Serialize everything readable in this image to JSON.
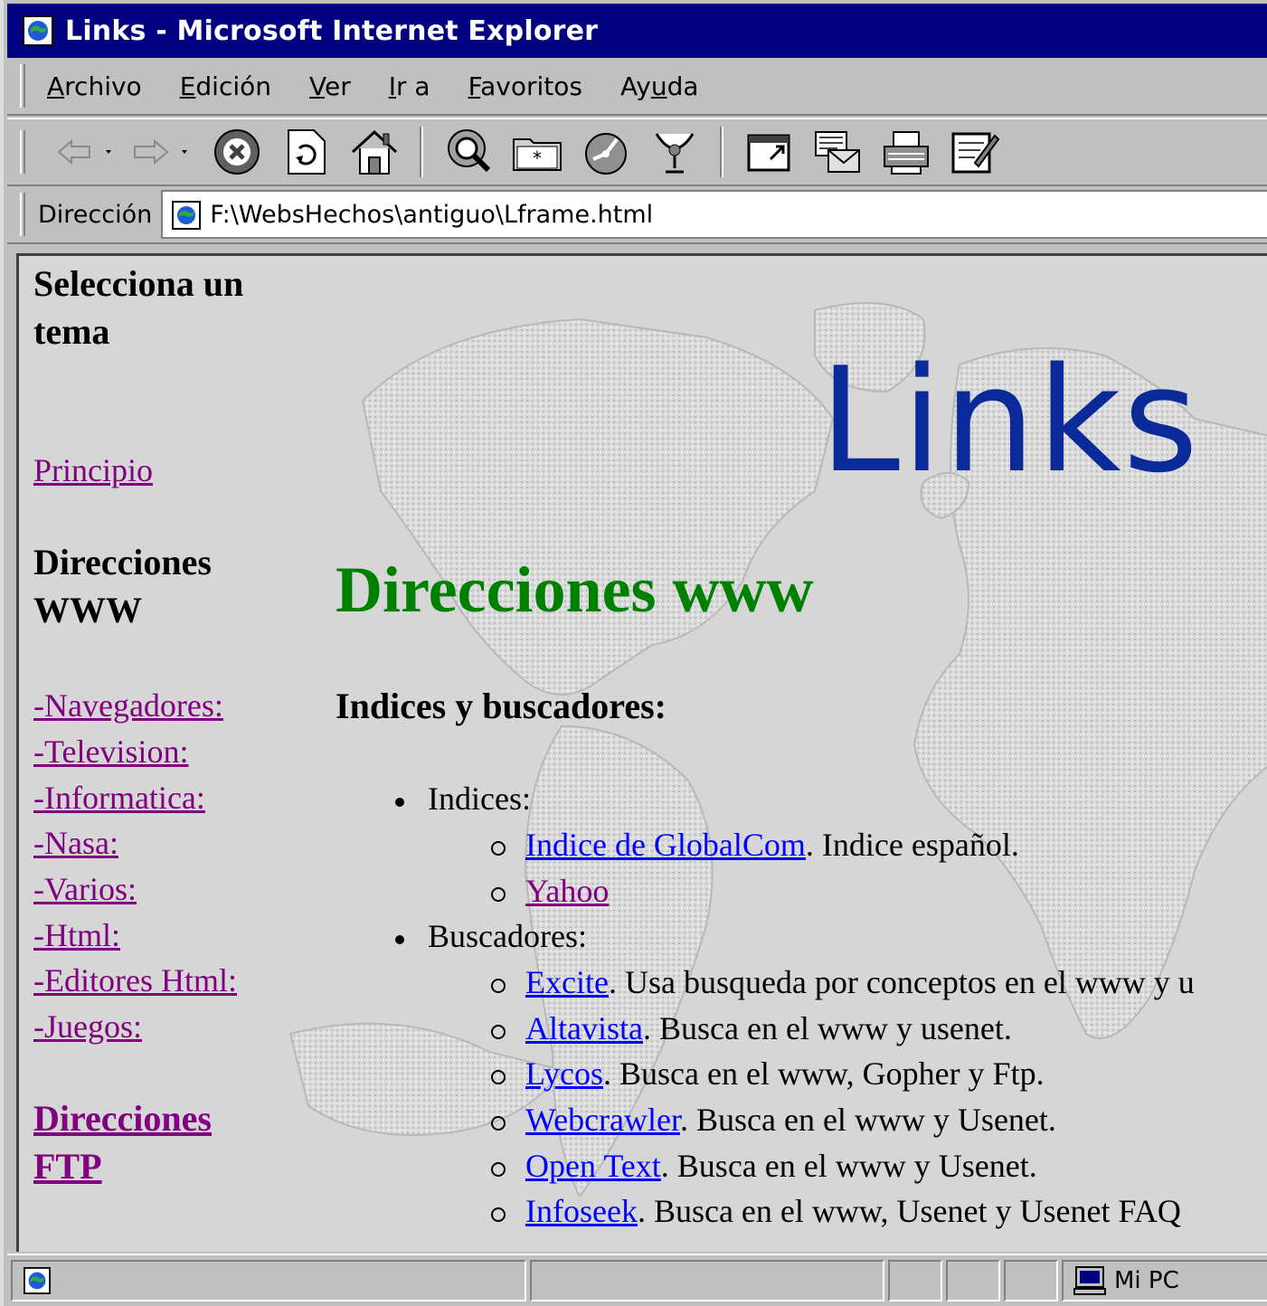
{
  "window": {
    "title": "Links - Microsoft Internet Explorer"
  },
  "menu": {
    "items": [
      {
        "pre": "",
        "u": "A",
        "post": "rchivo"
      },
      {
        "pre": "",
        "u": "E",
        "post": "dición"
      },
      {
        "pre": "",
        "u": "V",
        "post": "er"
      },
      {
        "pre": "",
        "u": "I",
        "post": "r a"
      },
      {
        "pre": "",
        "u": "F",
        "post": "avoritos"
      },
      {
        "pre": "Ay",
        "u": "u",
        "post": "da"
      }
    ]
  },
  "toolbar": {
    "icons": [
      "back-icon",
      "forward-icon",
      "stop-icon",
      "refresh-icon",
      "home-icon",
      "search-icon",
      "favorites-icon",
      "history-icon",
      "channels-icon",
      "fullscreen-icon",
      "mail-icon",
      "print-icon",
      "edit-icon"
    ]
  },
  "address": {
    "label": "Dirección",
    "url": "F:\\WebsHechos\\antiguo\\Lframe.html"
  },
  "left_frame": {
    "heading": "Selecciona un tema",
    "home_link": "Principio",
    "www_heading": "Direcciones WWW",
    "links": [
      "-Navegadores:",
      "-Television:",
      "-Informatica:",
      "-Nasa:",
      "-Varios:",
      "-Html:",
      "-Editores Html:",
      "-Juegos:"
    ],
    "ftp_link": "Direcciones FTP"
  },
  "main_frame": {
    "logo_text": "Links",
    "title": "Direcciones www",
    "subtitle": "Indices y buscadores:",
    "indices_label": "Indices:",
    "indices": [
      {
        "link": "Indice de GlobalCom",
        "desc": ". Indice español.",
        "visited": false
      },
      {
        "link": "Yahoo",
        "desc": "",
        "visited": true
      }
    ],
    "buscadores_label": "Buscadores:",
    "buscadores": [
      {
        "link": "Excite",
        "desc": ". Usa busqueda por conceptos en el www y u"
      },
      {
        "link": "Altavista",
        "desc": ". Busca en el www y usenet."
      },
      {
        "link": "Lycos",
        "desc": ". Busca en el www, Gopher y Ftp."
      },
      {
        "link": "Webcrawler",
        "desc": ". Busca en el www y Usenet."
      },
      {
        "link": "Open Text",
        "desc": ". Busca en el www y Usenet."
      },
      {
        "link": "Infoseek",
        "desc": ". Busca en el www, Usenet y Usenet FAQ"
      }
    ]
  },
  "statusbar": {
    "zone": "Mi PC"
  },
  "colors": {
    "titlebar": "#000080",
    "link": "#0000ff",
    "visited": "#800080",
    "title_green": "#008000",
    "logo_blue": "#0a2a9a"
  }
}
